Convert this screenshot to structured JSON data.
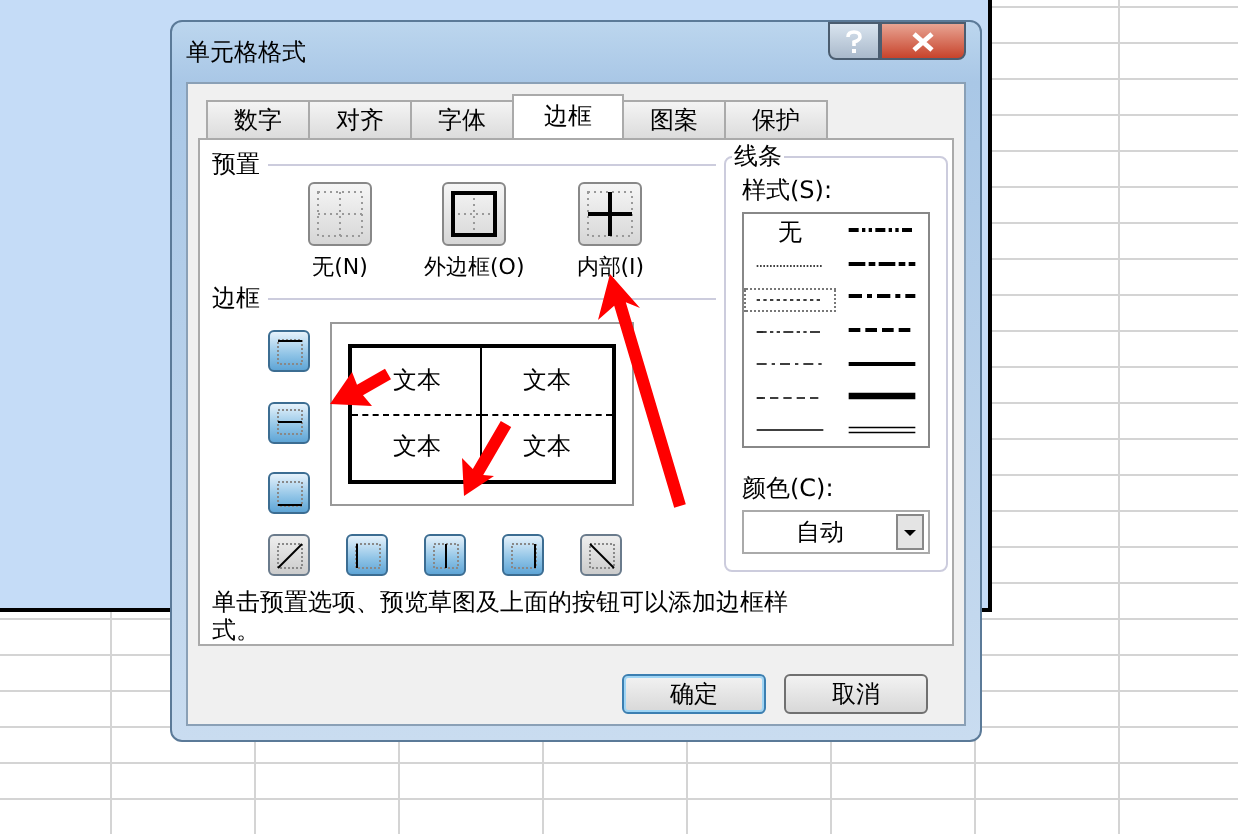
{
  "dialog": {
    "title": "单元格格式"
  },
  "tabs": [
    {
      "label": "数字",
      "selected": false
    },
    {
      "label": "对齐",
      "selected": false
    },
    {
      "label": "字体",
      "selected": false
    },
    {
      "label": "边框",
      "selected": true
    },
    {
      "label": "图案",
      "selected": false
    },
    {
      "label": "保护",
      "selected": false
    }
  ],
  "presets": {
    "label": "预置",
    "items": [
      {
        "kind": "none",
        "label": "无(N)"
      },
      {
        "kind": "outline",
        "label": "外边框(O)"
      },
      {
        "kind": "inside",
        "label": "内部(I)"
      }
    ]
  },
  "border": {
    "label": "边框",
    "side_buttons": [
      {
        "kind": "top",
        "on": true
      },
      {
        "kind": "middle-h",
        "on": true
      },
      {
        "kind": "bottom",
        "on": true
      }
    ],
    "bottom_buttons": [
      {
        "kind": "diag-up",
        "on": false
      },
      {
        "kind": "left",
        "on": true
      },
      {
        "kind": "middle-v",
        "on": true
      },
      {
        "kind": "right",
        "on": true
      },
      {
        "kind": "diag-down",
        "on": false
      }
    ],
    "preview_cells": [
      "文本",
      "文本",
      "文本",
      "文本"
    ]
  },
  "lines": {
    "label": "线条",
    "style_label": "样式(S):",
    "styles": [
      {
        "kind": "none",
        "label": "无",
        "selected": false
      },
      {
        "kind": "hair",
        "selected": false
      },
      {
        "kind": "dotted",
        "selected": true
      },
      {
        "kind": "dash-dot-dot",
        "selected": false
      },
      {
        "kind": "dash-dot",
        "selected": false
      },
      {
        "kind": "dashed",
        "selected": false
      },
      {
        "kind": "thin",
        "selected": false
      },
      {
        "kind": "medium-dash-dot-dot",
        "selected": false
      },
      {
        "kind": "slanted-dash-dot",
        "selected": false
      },
      {
        "kind": "medium-dash-dot",
        "selected": false
      },
      {
        "kind": "medium-dashed",
        "selected": false
      },
      {
        "kind": "medium",
        "selected": false
      },
      {
        "kind": "thick",
        "selected": false
      },
      {
        "kind": "double",
        "selected": false
      }
    ],
    "color_label": "颜色(C):",
    "color_value": "自动"
  },
  "hint": "单击预置选项、预览草图及上面的按钮可以添加边框样式。",
  "buttons": [
    {
      "label": "确定",
      "default": true
    },
    {
      "label": "取消",
      "default": false
    }
  ]
}
